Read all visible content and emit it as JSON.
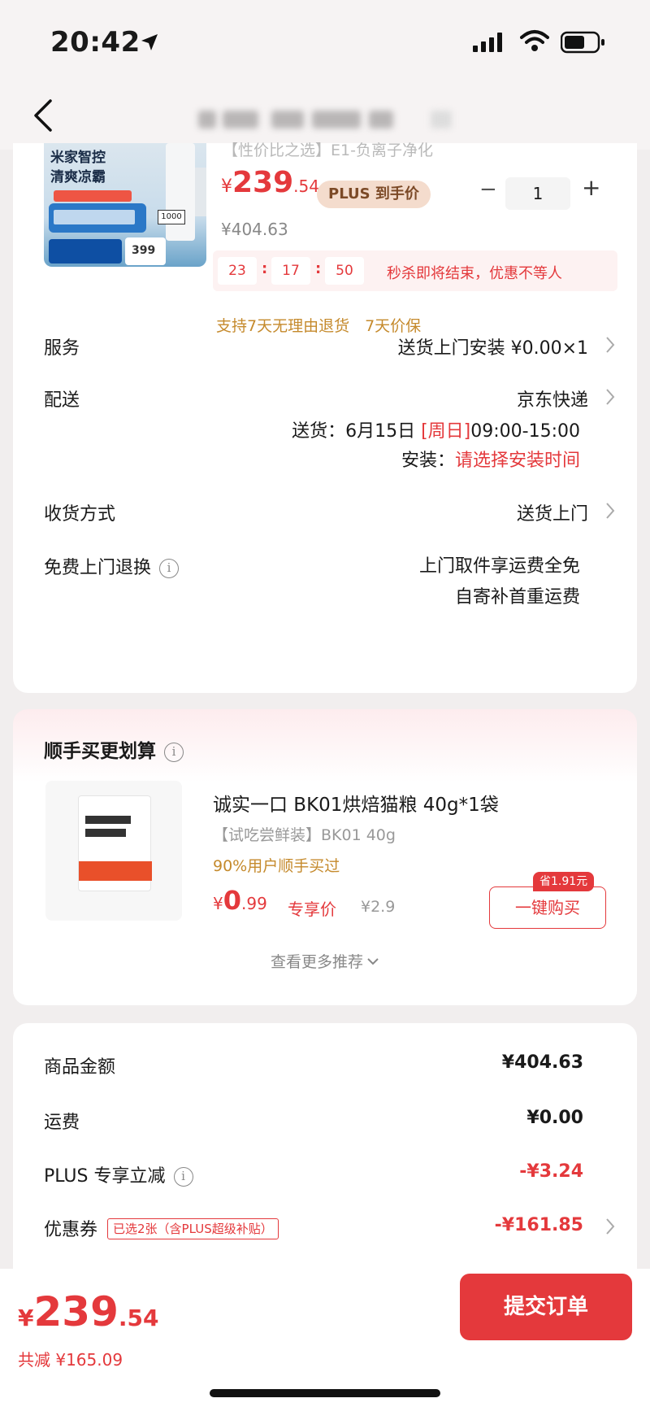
{
  "status_bar": {
    "time": "20:42"
  },
  "header": {
    "back_icon": "chevron-left-icon",
    "title": ""
  },
  "product": {
    "name": "【性价比之选】E1-负离子净化",
    "image_text": "米家智控\n清爽凉霸",
    "image_price": "399",
    "image_box": "1000",
    "price_symbol": "¥",
    "price_int": "239",
    "price_dec": ".54",
    "plus_badge": "PLUS 到手价",
    "original_price": "¥404.63",
    "quantity": "1",
    "minus": "−",
    "plus": "+",
    "countdown": {
      "h": "23",
      "m": "17",
      "s": "50",
      "sep": ":",
      "text": "秒杀即将结束，优惠不等人"
    },
    "guarantee": "支持7天无理由退货　7天价保"
  },
  "rows": {
    "service": {
      "label": "服务",
      "value": "送货上门安装 ¥0.00×1"
    },
    "delivery": {
      "label": "配送",
      "value": "京东快递",
      "date_prefix": "送货：6月15日",
      "date_day": "[周日]",
      "date_time": "09:00-15:00",
      "install_prefix": "安装：",
      "install_value": "请选择安装时间"
    },
    "receive": {
      "label": "收货方式",
      "value": "送货上门"
    },
    "return": {
      "label": "免费上门退换",
      "line1": "上门取件享运费全免",
      "line2": "自寄补首重运费"
    }
  },
  "addon": {
    "title": "顺手买更划算",
    "item_title": "诚实一口 BK01烘焙猫粮 40g*1袋",
    "item_sub": "【试吃尝鲜装】BK01 40g",
    "item_users": "90%用户顺手买过",
    "price_symbol": "¥",
    "price_int": "0",
    "price_dec": ".99",
    "price_label": "专享价",
    "old_price": "¥2.9",
    "save_tag": "省1.91元",
    "buy_button": "一键购买",
    "more": "查看更多推荐"
  },
  "summary": {
    "goods": {
      "label": "商品金额",
      "value": "¥404.63"
    },
    "shipping": {
      "label": "运费",
      "value": "¥0.00"
    },
    "plus": {
      "label": "PLUS 专享立减",
      "value": "-¥3.24"
    },
    "coupon": {
      "label": "优惠券",
      "tag": "已选2张（含PLUS超级补贴）",
      "value": "-¥161.85"
    }
  },
  "bottom": {
    "symbol": "¥",
    "int": "239",
    "dec": ".54",
    "save": "共减 ¥165.09",
    "submit": "提交订单"
  },
  "colors": {
    "accent": "#e4393c",
    "gold": "#c58a2c",
    "background": "#f1eeee"
  }
}
